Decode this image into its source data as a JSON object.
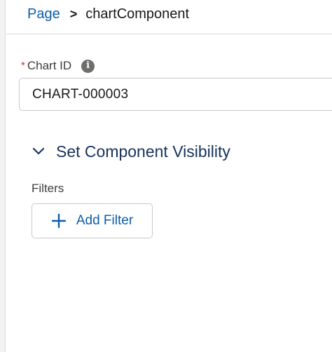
{
  "breadcrumb": {
    "parent_label": "Page",
    "separator": ">",
    "current_label": "chartComponent"
  },
  "chart_id_field": {
    "required_marker": "*",
    "label": "Chart ID",
    "info_icon": "info-icon",
    "value": "CHART-000003"
  },
  "visibility_section": {
    "toggle_icon": "chevron-down-icon",
    "title": "Set Component Visibility",
    "filters_label": "Filters",
    "add_filter_icon": "plus-icon",
    "add_filter_label": "Add Filter"
  },
  "colors": {
    "link": "#0b5cab",
    "section_title": "#16325c",
    "required": "#c23934",
    "border": "#c9c9c9"
  }
}
